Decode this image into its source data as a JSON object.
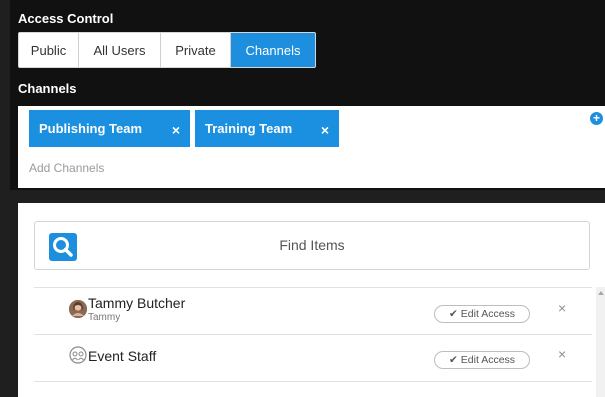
{
  "access_control": {
    "title": "Access Control",
    "options": [
      "Public",
      "All Users",
      "Private",
      "Channels"
    ],
    "active": "Channels"
  },
  "channels": {
    "title": "Channels",
    "tags": [
      "Publishing Team",
      "Training Team"
    ],
    "remove_glyph": "×",
    "add_placeholder": "Add Channels",
    "add_icon": "plus-circle-icon"
  },
  "search": {
    "placeholder": "Find Items",
    "icon": "search-icon"
  },
  "items": [
    {
      "name": "Tammy Butcher",
      "username": "Tammy",
      "avatar": "user-photo",
      "edit_label": "Edit Access",
      "remove_glyph": "×"
    },
    {
      "name": "Event Staff",
      "username": "",
      "avatar": "group-icon",
      "edit_label": "Edit Access",
      "remove_glyph": "×"
    }
  ],
  "colors": {
    "accent": "#1e8fde",
    "background": "#111111"
  }
}
